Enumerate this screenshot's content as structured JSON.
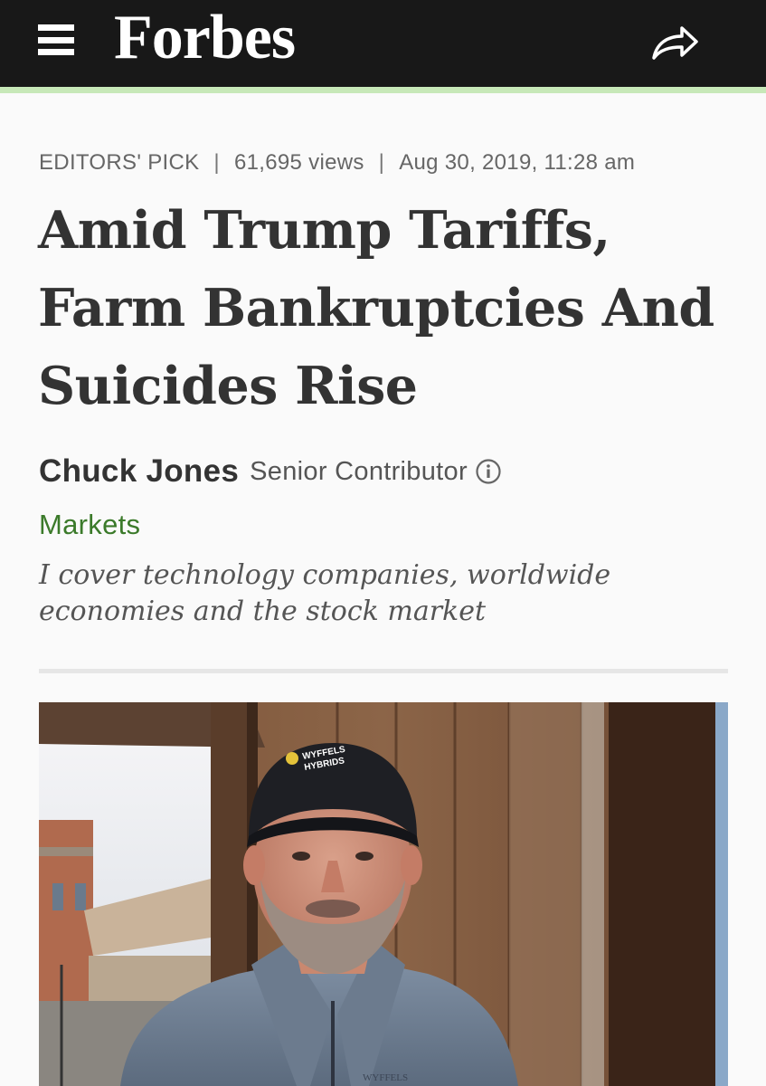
{
  "header": {
    "logo_text": "Forbes",
    "menu_icon": "hamburger-menu-icon",
    "share_icon": "share-arrow-icon",
    "background_color": "#181818",
    "accent_color": "#c7e8b8"
  },
  "article": {
    "meta": {
      "label": "EDITORS' PICK",
      "views": "61,695 views",
      "date": "Aug 30, 2019, 11:28 am"
    },
    "headline_lines": [
      "Amid Trump Tariffs,",
      "Farm Bankruptcies And",
      "Suicides Rise"
    ],
    "author": {
      "name": "Chuck Jones",
      "role": "Senior Contributor",
      "info_icon": "info-circle-icon"
    },
    "section": "Markets",
    "bio_lines": [
      "I cover technology companies, worldwide",
      "economies and the stock market"
    ],
    "image": {
      "cap_text_lines": [
        "WYFFELS",
        "HYBRIDS"
      ],
      "shirt_logo_text": "WYFFELS"
    }
  },
  "colors": {
    "section_link": "#3b7a2a",
    "text_primary": "#333333",
    "text_meta": "#666666"
  }
}
